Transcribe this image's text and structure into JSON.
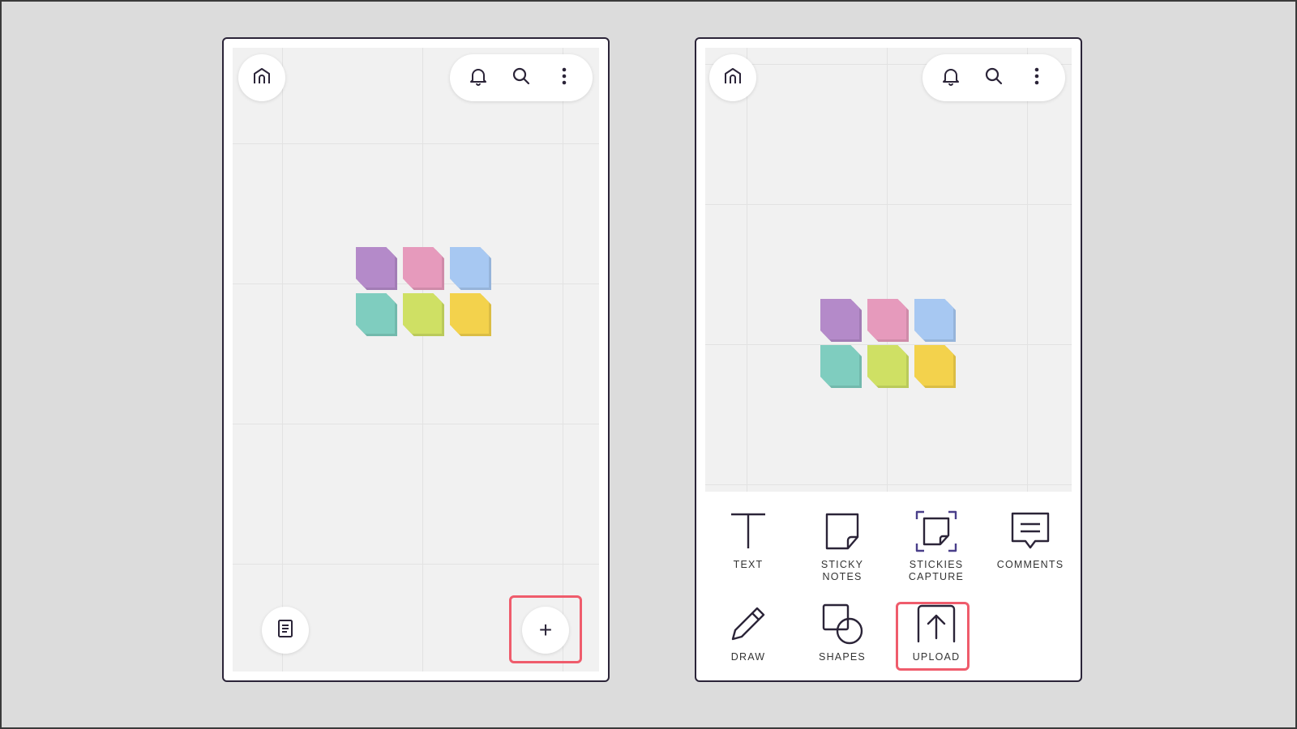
{
  "left_screen": {
    "fab_add_label": "+"
  },
  "right_screen": {
    "tools": [
      {
        "label": "TEXT",
        "icon": "text-icon"
      },
      {
        "label": "STICKY\nNOTES",
        "icon": "sticky-note-icon"
      },
      {
        "label": "STICKIES\nCAPTURE",
        "icon": "stickies-capture-icon"
      },
      {
        "label": "COMMENTS",
        "icon": "comment-icon"
      },
      {
        "label": "DRAW",
        "icon": "pencil-icon"
      },
      {
        "label": "SHAPES",
        "icon": "shapes-icon"
      },
      {
        "label": "UPLOAD",
        "icon": "upload-icon"
      }
    ]
  },
  "sticky_colors": [
    "#b48ac9",
    "#e69abc",
    "#a7c8f2",
    "#7fcdbf",
    "#cfe064",
    "#f3d24c"
  ],
  "highlight_color": "#ef5c6c",
  "icons": [
    "home-icon",
    "bell-icon",
    "search-icon",
    "more-vertical-icon",
    "list-icon",
    "plus-icon"
  ]
}
